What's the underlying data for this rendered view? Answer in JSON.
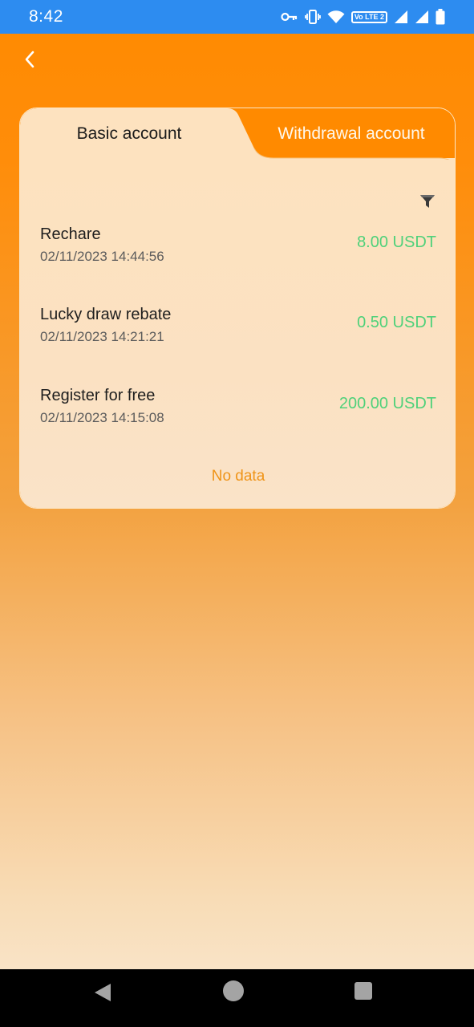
{
  "status_bar": {
    "time": "8:42",
    "volte": "Vo LTE 2",
    "icons": [
      "vpn-key-icon",
      "vibrate-icon",
      "wifi-icon",
      "volte-icon",
      "signal-1-icon",
      "signal-2-icon",
      "battery-icon"
    ]
  },
  "header": {
    "back_icon": "chevron-left-icon"
  },
  "tabs": [
    {
      "label": "Basic account",
      "active": true
    },
    {
      "label": "Withdrawal account",
      "active": false
    }
  ],
  "filter_icon": "filter-funnel-icon",
  "records": [
    {
      "title": "Rechare",
      "time": "02/11/2023 14:44:56",
      "amount": "8.00 USDT"
    },
    {
      "title": "Lucky draw rebate",
      "time": "02/11/2023 14:21:21",
      "amount": "0.50 USDT"
    },
    {
      "title": "Register for free",
      "time": "02/11/2023 14:15:08",
      "amount": "200.00 USDT"
    }
  ],
  "no_data": "No data",
  "colors": {
    "status_bar": "#2d8cf0",
    "header_orange": "#ff8a00",
    "amount_green": "#4fd17a",
    "no_data_orange": "#ef9418"
  },
  "nav": {
    "back": "nav-back-icon",
    "home": "nav-home-icon",
    "recents": "nav-recents-icon"
  }
}
